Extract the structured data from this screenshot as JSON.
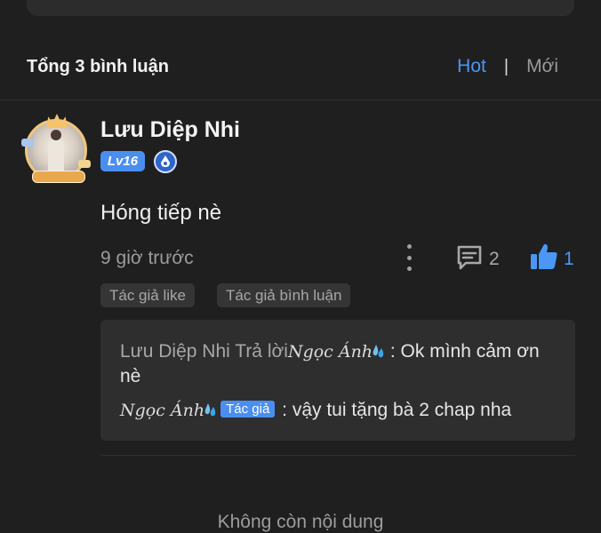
{
  "header": {
    "count_title": "Tổng 3 bình luận",
    "sort_hot": "Hot",
    "sort_separator": "|",
    "sort_new": "Mới",
    "accent": "#4a97f5"
  },
  "comment": {
    "username": "Lưu Diệp Nhi",
    "level": "Lv16",
    "text": "Hóng tiếp nè",
    "time": "9 giờ trước",
    "reply_count": "2",
    "like_count": "1",
    "chips": [
      "Tác giả like",
      "Tác giả bình luận"
    ],
    "icons": [
      "avatar",
      "author-badge-icon",
      "more-icon",
      "reply-icon",
      "thumbs-up-icon"
    ]
  },
  "replies": [
    {
      "user": "Lưu Diệp Nhi",
      "action": "Trả lời",
      "target": "Ngọc Ánh",
      "text": ": Ok mình cảm ơn nè"
    },
    {
      "user": "Ngọc Ánh",
      "badge": "Tác giả",
      "text": ": vậy tui tặng bà 2 chap nha"
    }
  ],
  "footer": {
    "end_text": "Không còn nội dung"
  }
}
